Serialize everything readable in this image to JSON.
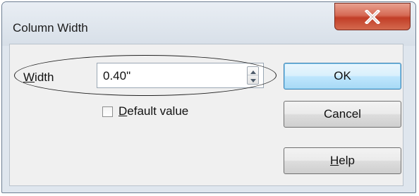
{
  "window": {
    "title": "Column Width",
    "close_icon": "close-x-icon"
  },
  "width_field": {
    "label_mnemonic": "W",
    "label_rest": "idth",
    "value": "0.40\""
  },
  "default_value": {
    "label_mnemonic": "D",
    "label_rest": "efault value",
    "checked": false
  },
  "buttons": {
    "ok": "OK",
    "cancel": "Cancel",
    "help_mnemonic": "H",
    "help_rest": "elp"
  },
  "colors": {
    "close_button": "#c9452e",
    "ok_button_border": "#3c7fb1"
  }
}
